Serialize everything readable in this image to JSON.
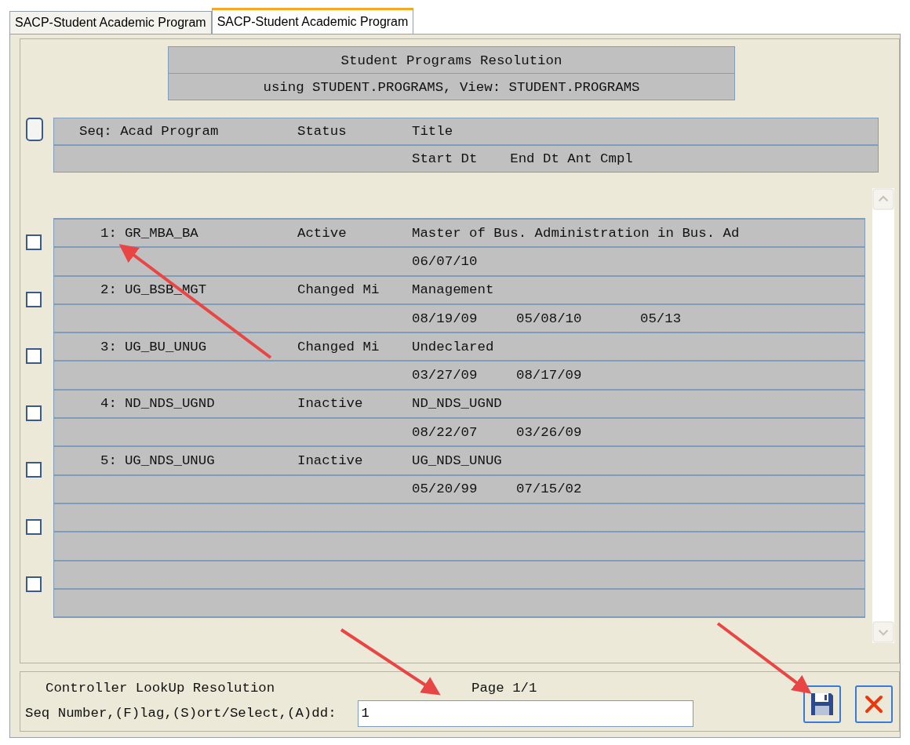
{
  "tabs": [
    {
      "label": "SACP-Student Academic Program",
      "selected": false
    },
    {
      "label": "SACP-Student Academic Program",
      "selected": true
    }
  ],
  "title_lines": [
    "Student Programs Resolution",
    "using STUDENT.PROGRAMS, View: STUDENT.PROGRAMS"
  ],
  "header": {
    "checked": false,
    "seq": "Seq: Acad Program",
    "status": "Status",
    "title": "Title",
    "dates": "Start Dt    End Dt Ant Cmpl"
  },
  "rows": [
    {
      "checked": false,
      "seq": "1:",
      "program": "GR_MBA_BA",
      "status": "Active",
      "title": "Master of Bus. Administration in Bus. Ad",
      "start_dt": "06/07/10"
    },
    {
      "checked": false,
      "seq": "2:",
      "program": "UG_BSB_MGT",
      "status": "Changed Mi",
      "title": "Management",
      "start_dt": "08/19/09",
      "end_dt": "05/08/10",
      "ant_cmpl": "05/13"
    },
    {
      "checked": false,
      "seq": "3:",
      "program": "UG_BU_UNUG",
      "status": "Changed Mi",
      "title": "Undeclared",
      "start_dt": "03/27/09",
      "end_dt": "08/17/09"
    },
    {
      "checked": false,
      "seq": "4:",
      "program": "ND_NDS_UGND",
      "status": "Inactive",
      "title": "ND_NDS_UGND",
      "start_dt": "08/22/07",
      "end_dt": "03/26/09"
    },
    {
      "checked": false,
      "seq": "5:",
      "program": "UG_NDS_UNUG",
      "status": "Inactive",
      "title": "UG_NDS_UNUG",
      "start_dt": "05/20/99",
      "end_dt": "07/15/02"
    },
    {
      "checked": false
    },
    {
      "checked": false
    }
  ],
  "footer": {
    "caption": "Controller LookUp Resolution",
    "page": "Page 1/1",
    "prompt": "Seq Number,(F)lag,(S)ort/Select,(A)dd:",
    "value": "1"
  }
}
